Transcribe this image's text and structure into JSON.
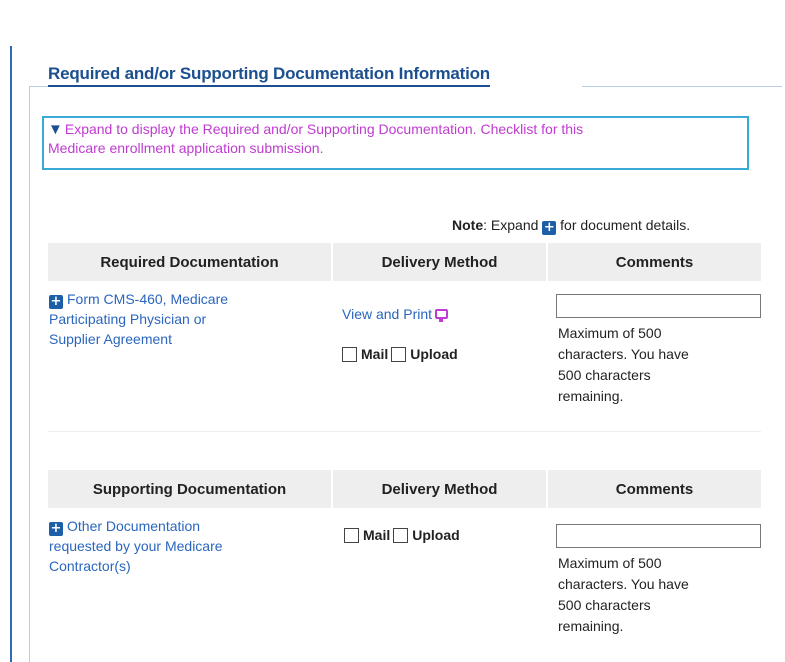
{
  "section": {
    "title": "Required and/or Supporting Documentation Information",
    "expand_line1": "Expand to display the Required and/or Supporting Documentation. Checklist for this",
    "expand_line2": "Medicare enrollment application submission.",
    "note_bold": "Note",
    "note_rest_a": ": Expand",
    "note_rest_b": "for document details."
  },
  "required": {
    "headers": [
      "Required Documentation",
      "Delivery Method",
      "Comments"
    ],
    "doc_lines": [
      "Form CMS-460, Medicare",
      "Participating Physician or",
      "Supplier Agreement"
    ],
    "view_print": "View and Print",
    "mail": "Mail",
    "upload": "Upload",
    "comment_value": "",
    "helper_lines": [
      "Maximum of 500",
      "characters. You have",
      "500 characters",
      "remaining."
    ]
  },
  "supporting": {
    "headers": [
      "Supporting Documentation",
      "Delivery Method",
      "Comments"
    ],
    "doc_lines": [
      "Other Documentation",
      "requested by your Medicare",
      "Contractor(s)"
    ],
    "mail": "Mail",
    "upload": "Upload",
    "comment_value": "",
    "helper_lines": [
      "Maximum of 500",
      "characters. You have",
      "500 characters",
      "remaining."
    ]
  },
  "icons": {
    "expand_triangle": "triangle-down-icon",
    "plus": "plus-icon",
    "print": "print-preview-icon"
  },
  "colors": {
    "link": "#2a66bd",
    "title": "#1b4f8f",
    "magenta": "#c03bd1",
    "focus_border": "#39a9d6",
    "header_bg": "#eeeeee"
  }
}
